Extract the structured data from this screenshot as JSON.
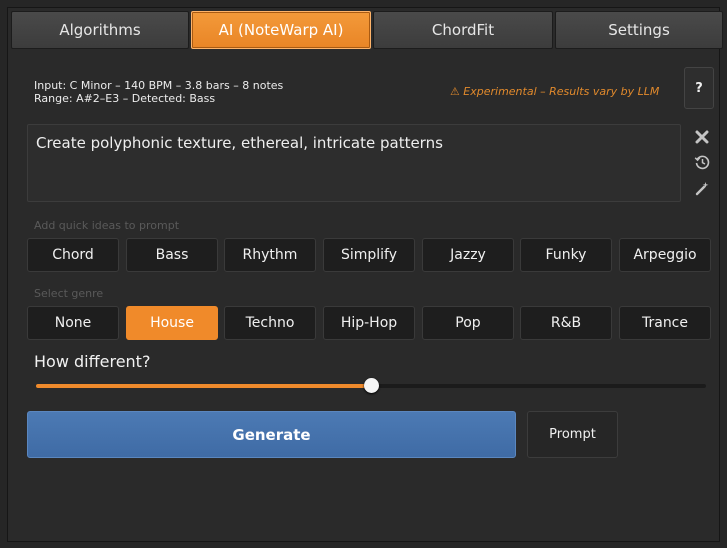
{
  "tabs": [
    {
      "label": "Algorithms",
      "active": false
    },
    {
      "label": "AI (NoteWarp AI)",
      "active": true
    },
    {
      "label": "ChordFit",
      "active": false
    },
    {
      "label": "Settings",
      "active": false
    }
  ],
  "info": {
    "line1": "Input: C Minor – 140 BPM – 3.8 bars – 8 notes",
    "line2": "Range: A#2–E3 – Detected: Bass"
  },
  "experimental_note": "⚠ Experimental – Results vary by LLM",
  "help_label": "?",
  "prompt_text": "Create polyphonic texture, ethereal, intricate patterns",
  "icons": {
    "clear": "close-icon",
    "history": "history-icon",
    "magic": "magic-wand-icon"
  },
  "quick_ideas": {
    "label": "Add quick ideas to prompt",
    "items": [
      "Chord",
      "Bass",
      "Rhythm",
      "Simplify",
      "Jazzy",
      "Funky",
      "Arpeggio"
    ]
  },
  "genre": {
    "label": "Select genre",
    "items": [
      "None",
      "House",
      "Techno",
      "Hip-Hop",
      "Pop",
      "R&B",
      "Trance"
    ],
    "selected": "House"
  },
  "difference": {
    "label": "How different?",
    "value": 0.5
  },
  "buttons": {
    "generate": "Generate",
    "prompt": "Prompt"
  },
  "colors": {
    "accent": "#f08a2a",
    "generate": "#4673ad"
  }
}
